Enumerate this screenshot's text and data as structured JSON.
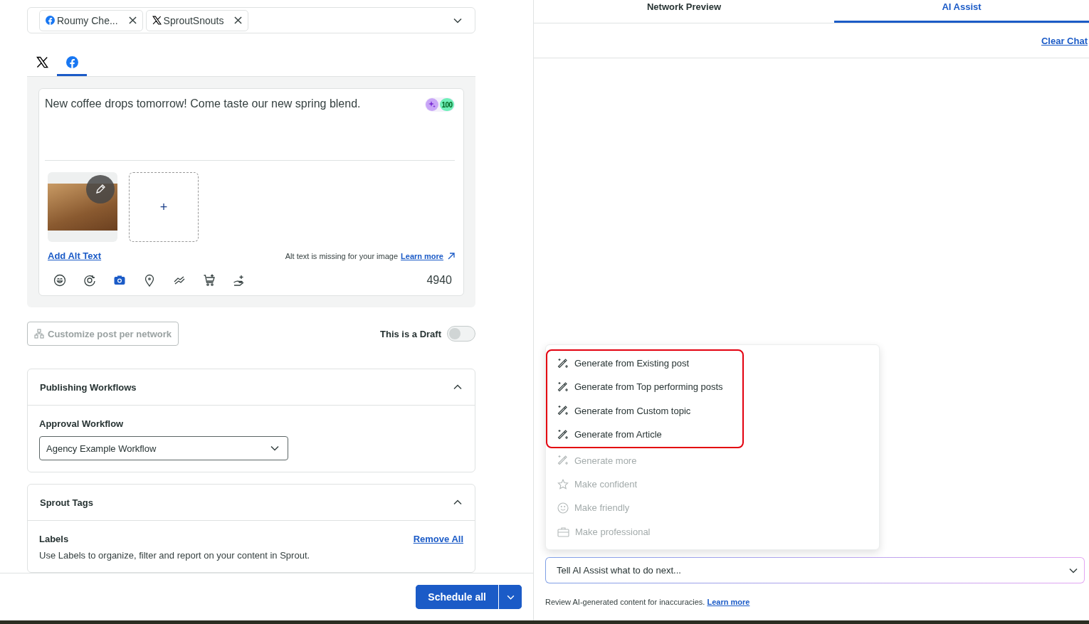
{
  "accounts": [
    {
      "kind": "facebook",
      "name": "Roumy Che..."
    },
    {
      "kind": "x",
      "name": "SproutSnouts"
    }
  ],
  "network_tabs": [
    {
      "kind": "x",
      "selected": false
    },
    {
      "kind": "facebook",
      "selected": true
    }
  ],
  "post": {
    "text": "New coffee drops tomorrow! Come taste our new spring blend.",
    "score": "100",
    "add_media": "+",
    "add_alt_text": "Add Alt Text",
    "alt_warning": "Alt text is missing for your image",
    "alt_learn_more": "Learn more",
    "char_count": "4940"
  },
  "customize_button": "Customize post per network",
  "draft": {
    "label": "This is a Draft",
    "on": false
  },
  "publishing_workflows": {
    "title": "Publishing Workflows",
    "expanded": true,
    "field_label": "Approval Workflow",
    "value": "Agency Example Workflow"
  },
  "sprout_tags": {
    "title": "Sprout Tags",
    "expanded": true,
    "labels_title": "Labels",
    "remove_all": "Remove All",
    "description": "Use Labels to organize, filter and report on your content in Sprout."
  },
  "schedule_button": "Schedule all",
  "right_tabs": [
    {
      "label": "Network Preview",
      "selected": false
    },
    {
      "label": "AI Assist",
      "selected": true
    }
  ],
  "clear_chat": "Clear Chat",
  "ai_menu": [
    {
      "kind": "generate",
      "label": "Generate from Existing post",
      "disabled": false,
      "highlighted": true
    },
    {
      "kind": "generate",
      "label": "Generate from Top performing posts",
      "disabled": false,
      "highlighted": true
    },
    {
      "kind": "generate",
      "label": "Generate from Custom topic",
      "disabled": false,
      "highlighted": true
    },
    {
      "kind": "generate",
      "label": "Generate from Article",
      "disabled": false,
      "highlighted": true
    },
    {
      "kind": "generate",
      "label": "Generate more",
      "disabled": true,
      "highlighted": false
    },
    {
      "kind": "confident",
      "label": "Make confident",
      "disabled": true,
      "highlighted": false
    },
    {
      "kind": "friendly",
      "label": "Make friendly",
      "disabled": true,
      "highlighted": false
    },
    {
      "kind": "professional",
      "label": "Make professional",
      "disabled": true,
      "highlighted": false
    }
  ],
  "prompt": {
    "placeholder": "Tell AI Assist what to do next..."
  },
  "disclaimer": {
    "text": "Review AI-generated content for inaccuracies.",
    "link": "Learn more"
  }
}
